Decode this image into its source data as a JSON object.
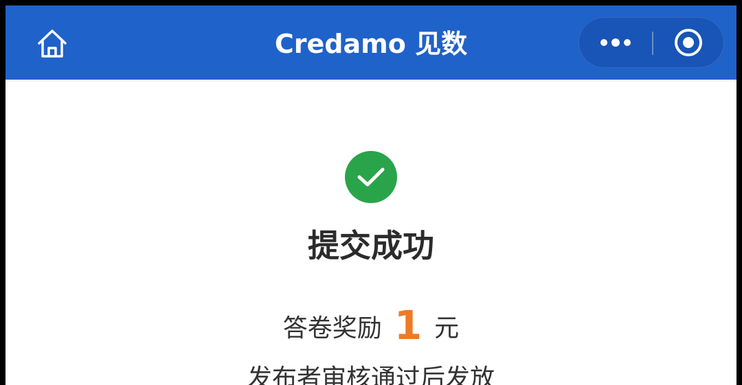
{
  "navbar": {
    "title": "Credamo 见数",
    "home_icon": "home-icon",
    "more_icon": "more-dots-icon",
    "close_icon": "close-target-icon",
    "background_color": "#1f62c9"
  },
  "result": {
    "status_icon": "check-circle-icon",
    "status_color": "#2aa44a",
    "title": "提交成功",
    "reward_prefix": "答卷奖励",
    "reward_amount": "1",
    "reward_unit": "元",
    "reward_color": "#ef7a25",
    "note": "发布者审核通过后发放"
  }
}
